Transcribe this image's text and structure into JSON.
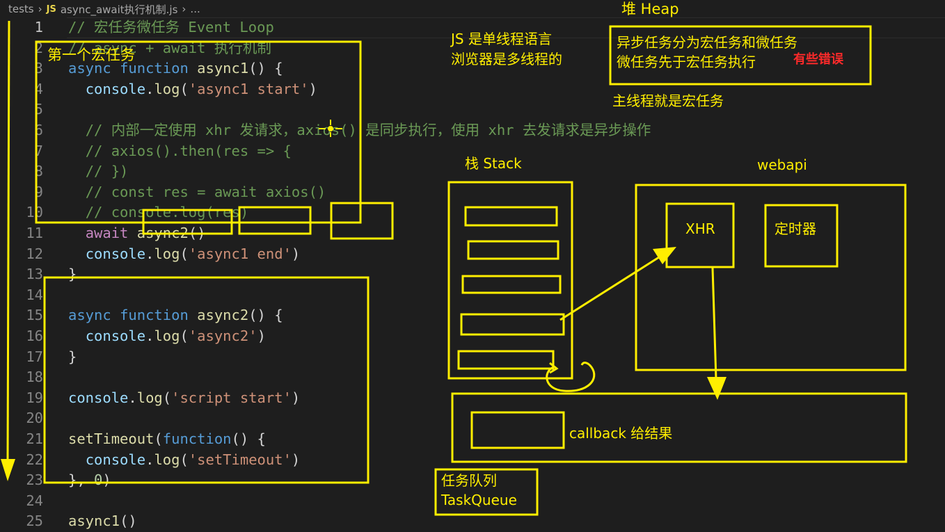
{
  "breadcrumb": {
    "folder": "tests",
    "file_icon": "JS",
    "file": "async_await执行机制.js",
    "more": "..."
  },
  "editor": {
    "active_line": 1,
    "lines": [
      {
        "n": "1",
        "indent": "",
        "tokens": [
          [
            "// 宏任务微任务 Event Loop",
            "c"
          ]
        ]
      },
      {
        "n": "2",
        "indent": "",
        "tokens": [
          [
            "// async + await 执行机制",
            "c"
          ]
        ]
      },
      {
        "n": "3",
        "indent": "",
        "tokens": [
          [
            "async ",
            "k"
          ],
          [
            "function ",
            "k"
          ],
          [
            "async1",
            "f"
          ],
          [
            "() {",
            "p"
          ]
        ]
      },
      {
        "n": "4",
        "indent": "  ",
        "tokens": [
          [
            "console",
            "v"
          ],
          [
            ".",
            "p"
          ],
          [
            "log",
            "f"
          ],
          [
            "(",
            "p"
          ],
          [
            "'async1 start'",
            "s"
          ],
          [
            ")",
            "p"
          ]
        ]
      },
      {
        "n": "5",
        "indent": "",
        "tokens": []
      },
      {
        "n": "6",
        "indent": "  ",
        "tokens": [
          [
            "// 内部一定使用 xhr 发请求，axios() 是同步执行，使用 xhr 去发请求是异步操作",
            "c"
          ]
        ]
      },
      {
        "n": "7",
        "indent": "  ",
        "tokens": [
          [
            "// axios().then(res => {",
            "c"
          ]
        ]
      },
      {
        "n": "8",
        "indent": "  ",
        "tokens": [
          [
            "// })",
            "c"
          ]
        ]
      },
      {
        "n": "9",
        "indent": "  ",
        "tokens": [
          [
            "// const res = await axios()",
            "c"
          ]
        ]
      },
      {
        "n": "10",
        "indent": "  ",
        "tokens": [
          [
            "// console.log(res)",
            "c"
          ]
        ]
      },
      {
        "n": "11",
        "indent": "  ",
        "tokens": [
          [
            "await ",
            "a"
          ],
          [
            "async2",
            "f"
          ],
          [
            "()",
            "p"
          ]
        ]
      },
      {
        "n": "12",
        "indent": "  ",
        "tokens": [
          [
            "console",
            "v"
          ],
          [
            ".",
            "p"
          ],
          [
            "log",
            "f"
          ],
          [
            "(",
            "p"
          ],
          [
            "'async1 end'",
            "s"
          ],
          [
            ")",
            "p"
          ]
        ]
      },
      {
        "n": "13",
        "indent": "",
        "tokens": [
          [
            "}",
            "p"
          ]
        ]
      },
      {
        "n": "14",
        "indent": "",
        "tokens": []
      },
      {
        "n": "15",
        "indent": "",
        "tokens": [
          [
            "async ",
            "k"
          ],
          [
            "function ",
            "k"
          ],
          [
            "async2",
            "f"
          ],
          [
            "() {",
            "p"
          ]
        ]
      },
      {
        "n": "16",
        "indent": "  ",
        "tokens": [
          [
            "console",
            "v"
          ],
          [
            ".",
            "p"
          ],
          [
            "log",
            "f"
          ],
          [
            "(",
            "p"
          ],
          [
            "'async2'",
            "s"
          ],
          [
            ")",
            "p"
          ]
        ]
      },
      {
        "n": "17",
        "indent": "",
        "tokens": [
          [
            "}",
            "p"
          ]
        ]
      },
      {
        "n": "18",
        "indent": "",
        "tokens": []
      },
      {
        "n": "19",
        "indent": "",
        "tokens": [
          [
            "console",
            "v"
          ],
          [
            ".",
            "p"
          ],
          [
            "log",
            "f"
          ],
          [
            "(",
            "p"
          ],
          [
            "'script start'",
            "s"
          ],
          [
            ")",
            "p"
          ]
        ]
      },
      {
        "n": "20",
        "indent": "",
        "tokens": []
      },
      {
        "n": "21",
        "indent": "",
        "tokens": [
          [
            "setTimeout",
            "f"
          ],
          [
            "(",
            "p"
          ],
          [
            "function",
            "k"
          ],
          [
            "() {",
            "p"
          ]
        ]
      },
      {
        "n": "22",
        "indent": "  ",
        "tokens": [
          [
            "console",
            "v"
          ],
          [
            ".",
            "p"
          ],
          [
            "log",
            "f"
          ],
          [
            "(",
            "p"
          ],
          [
            "'setTimeout'",
            "s"
          ],
          [
            ")",
            "p"
          ]
        ]
      },
      {
        "n": "23",
        "indent": "",
        "tokens": [
          [
            "}, ",
            "p"
          ],
          [
            "0",
            "n"
          ],
          [
            ")",
            "p"
          ]
        ]
      },
      {
        "n": "24",
        "indent": "",
        "tokens": []
      },
      {
        "n": "25",
        "indent": "",
        "tokens": [
          [
            "async1",
            "f"
          ],
          [
            "()",
            "p"
          ]
        ]
      }
    ]
  },
  "annotations": {
    "first_macrotask": "第一个宏任务",
    "heap": "堆 Heap",
    "js_single_thread": "JS 是单线程语言",
    "browser_multi_thread": "浏览器是多线程的",
    "async_split": "异步任务分为宏任务和微任务",
    "micro_before_macro": "微任务先于宏任务执行",
    "error_note": "有些错误",
    "main_thread": "主线程就是宏任务",
    "stack": "栈  Stack",
    "webapi": "webapi",
    "xhr": "XHR",
    "timer": "定时器",
    "callback": "callback 给结果",
    "task_queue_cn": "任务队列",
    "task_queue_en": "TaskQueue"
  },
  "colors": {
    "annotation": "#ffee00",
    "error": "#ff2a2a",
    "background": "#1e1e1e"
  }
}
